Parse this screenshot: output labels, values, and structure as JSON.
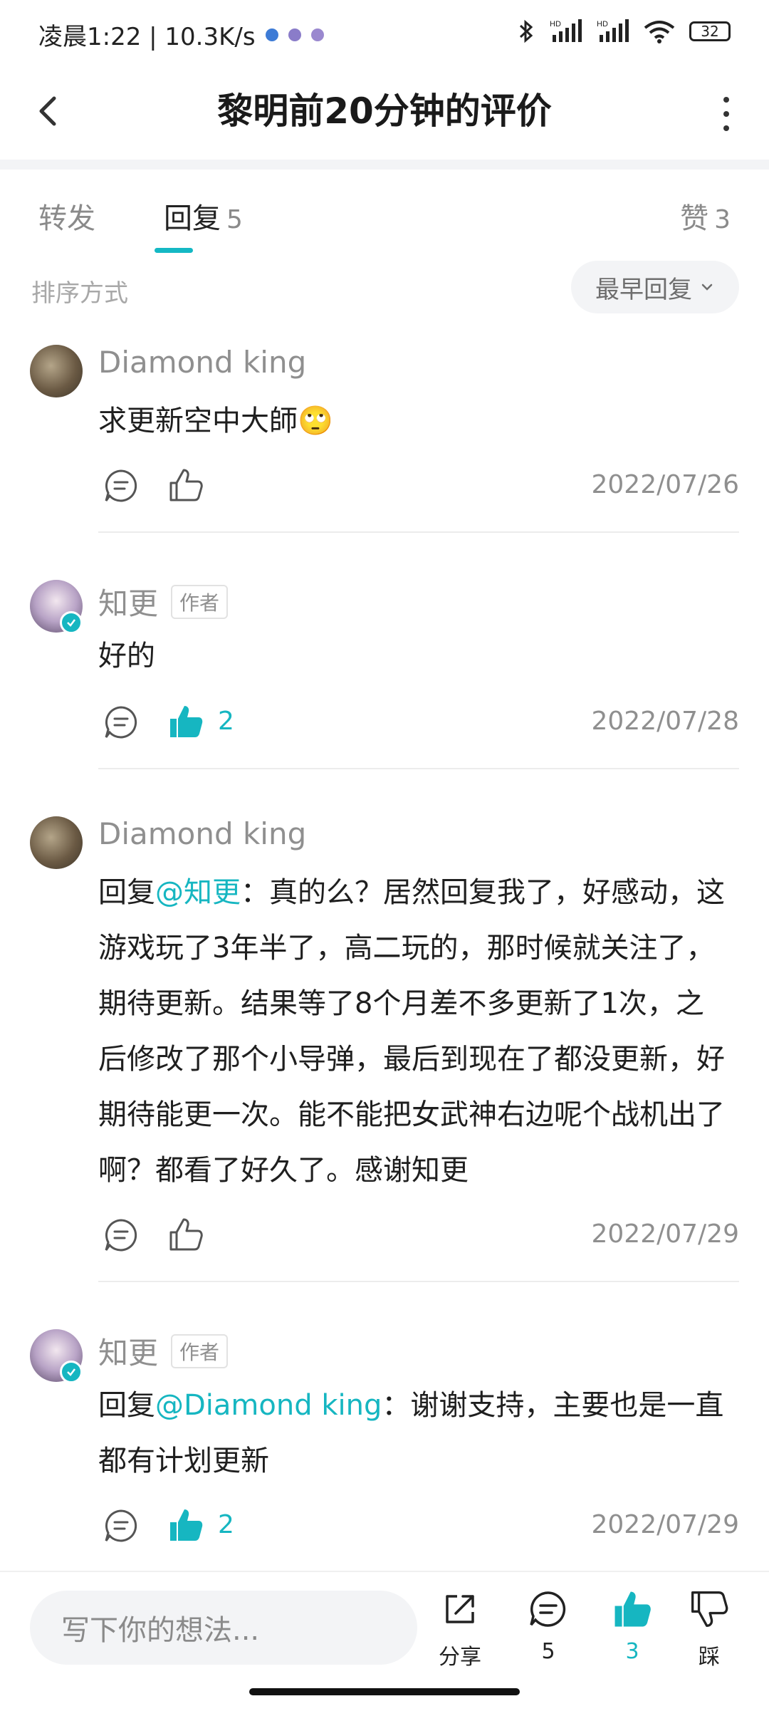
{
  "status_bar": {
    "time_speed": "凌晨1:22 | 10.3K/s",
    "battery": "32",
    "hd1": "HD",
    "hd2": "HD"
  },
  "header": {
    "title": "黎明前20分钟的评价"
  },
  "tabs": {
    "forward": "转发",
    "reply": "回复",
    "reply_count": "5",
    "like": "赞",
    "like_count": "3"
  },
  "sort": {
    "label": "排序方式",
    "value": "最早回复"
  },
  "comments": [
    {
      "name": "Diamond king",
      "text": "求更新空中大師🙄",
      "likes": "",
      "date": "2022/07/26",
      "liked": false
    },
    {
      "name": "知更",
      "tag": "作者",
      "text": "好的",
      "likes": "2",
      "date": "2022/07/28",
      "liked": true
    },
    {
      "name": "Diamond king",
      "prefix": "回复",
      "mention": "@知更",
      "text": "：真的么？居然回复我了，好感动，这游戏玩了3年半了，高二玩的，那时候就关注了，期待更新。结果等了8个月差不多更新了1次，之后修改了那个小导弹，最后到现在了都没更新，好期待能更一次。能不能把女武神右边呢个战机出了啊？都看了好久了。感谢知更",
      "likes": "",
      "date": "2022/07/29",
      "liked": false
    },
    {
      "name": "知更",
      "tag": "作者",
      "prefix": "回复",
      "mention": "@Diamond king",
      "text": "：谢谢支持，主要也是一直都有计划更新",
      "likes": "2",
      "date": "2022/07/29",
      "liked": true
    }
  ],
  "bottom_bar": {
    "placeholder": "写下你的想法...",
    "share": "分享",
    "comment_count": "5",
    "like_count": "3",
    "dislike": "踩"
  },
  "colors": {
    "accent": "#16b6c1",
    "muted_text": "#8f8f8f",
    "background": "#ffffff"
  }
}
